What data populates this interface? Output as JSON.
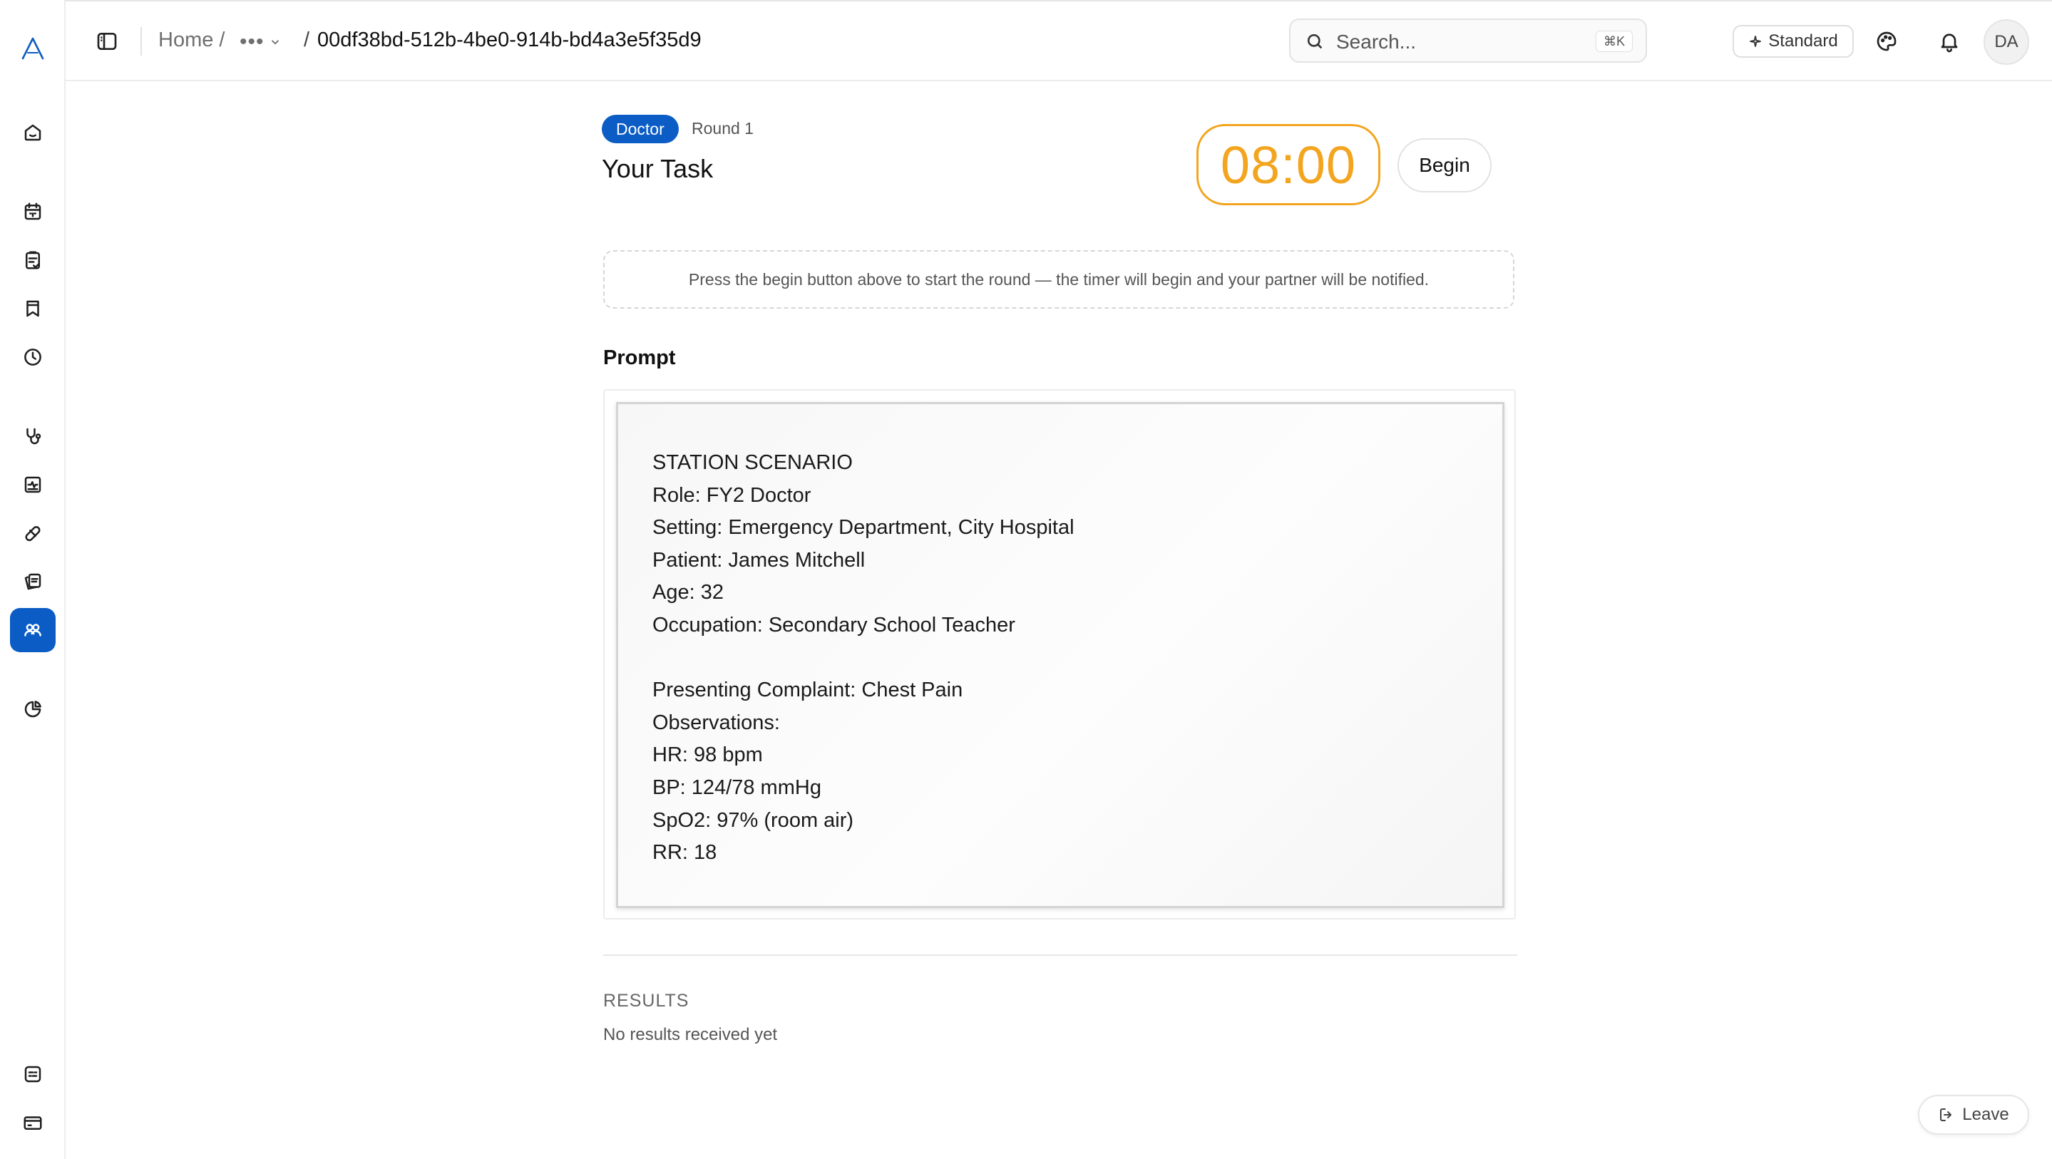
{
  "colors": {
    "accent": "#0b5cc4",
    "timer": "#f3a51f",
    "border": "#ececec"
  },
  "sidebar": {
    "logo": "app-logo",
    "items": [
      {
        "name": "home-icon",
        "active": false
      },
      {
        "name": "calendar-icon",
        "active": false
      },
      {
        "name": "clipboard-icon",
        "active": false
      },
      {
        "name": "bookmark-icon",
        "active": false
      },
      {
        "name": "clock-icon",
        "active": false
      },
      {
        "name": "stethoscope-icon",
        "active": false
      },
      {
        "name": "activity-icon",
        "active": false
      },
      {
        "name": "pill-icon",
        "active": false
      },
      {
        "name": "cards-icon",
        "active": false
      },
      {
        "name": "users-icon",
        "active": true
      },
      {
        "name": "pie-chart-icon",
        "active": false
      },
      {
        "name": "logs-icon",
        "active": false
      },
      {
        "name": "card-icon",
        "active": false
      }
    ]
  },
  "header": {
    "breadcrumb_home": "Home /",
    "breadcrumb_more": "•••",
    "breadcrumb_sep": "/",
    "breadcrumb_current": "00df38bd-512b-4be0-914b-bd4a3e5f35d9",
    "search_placeholder": "Search...",
    "search_shortcut": "⌘K",
    "mode_label": "Standard",
    "avatar_initials": "DA"
  },
  "task": {
    "role_badge": "Doctor",
    "round_label": "Round 1",
    "title": "Your Task",
    "timer": "08:00",
    "begin_label": "Begin",
    "notice": "Press the begin button above to start the round — the timer will begin and your partner will be notified."
  },
  "prompt": {
    "label": "Prompt",
    "lines": [
      "STATION SCENARIO",
      "Role: FY2 Doctor",
      "Setting: Emergency Department, City Hospital",
      "Patient: James Mitchell",
      "Age: 32",
      "Occupation: Secondary School Teacher",
      "",
      "Presenting Complaint: Chest Pain",
      "Observations:",
      "HR: 98 bpm",
      "BP: 124/78 mmHg",
      "SpO2: 97% (room air)",
      "RR: 18"
    ]
  },
  "results": {
    "label": "RESULTS",
    "empty": "No results received yet"
  },
  "leave_label": "Leave"
}
